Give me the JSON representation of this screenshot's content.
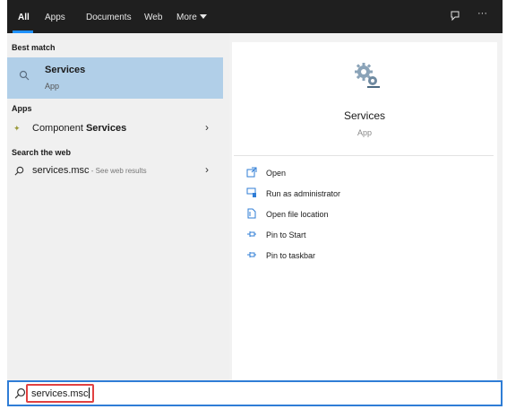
{
  "tabs": [
    {
      "label": "All",
      "active": true
    },
    {
      "label": "Apps"
    },
    {
      "label": "Documents"
    },
    {
      "label": "Web"
    },
    {
      "label": "More"
    }
  ],
  "top_icons": {
    "feedback": "feedback-icon",
    "more": "···"
  },
  "left": {
    "best_match_header": "Best match",
    "best_match": {
      "title": "Services",
      "subtitle": "App",
      "icon": "services-search-icon"
    },
    "apps_header": "Apps",
    "apps_item": {
      "prefix": "Component ",
      "bold": "Services",
      "icon": "component-services-icon"
    },
    "web_header": "Search the web",
    "web_item": {
      "query": "services.msc",
      "suffix": " - See web results",
      "icon": "search-icon"
    }
  },
  "right": {
    "app_title": "Services",
    "app_type": "App",
    "actions": [
      {
        "label": "Open",
        "icon": "open-icon"
      },
      {
        "label": "Run as administrator",
        "icon": "run-as-admin-icon"
      },
      {
        "label": "Open file location",
        "icon": "file-location-icon"
      },
      {
        "label": "Pin to Start",
        "icon": "pin-icon"
      },
      {
        "label": "Pin to taskbar",
        "icon": "pin-icon"
      }
    ]
  },
  "search": {
    "value": "services.msc",
    "icon": "search-icon"
  },
  "colors": {
    "accent": "#1e90ff",
    "selection": "#b1cfe8",
    "highlight": "#e14141",
    "topbar": "#1f1f1f"
  }
}
